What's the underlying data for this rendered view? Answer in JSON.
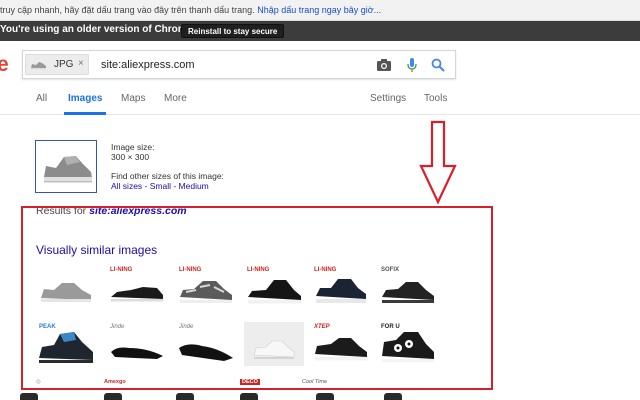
{
  "bookmark_bar": {
    "text": "truy cập nhanh, hãy đặt dấu trang vào đây trên thanh dấu trang.",
    "link": "Nhập dấu trang ngay bây giờ..."
  },
  "update_banner": {
    "message": "You're using an older version of Chrome.",
    "button_label": "Reinstall to stay secure"
  },
  "logo_fragment": "e",
  "search": {
    "chip_label": "JPG",
    "chip_close": "×",
    "query": "site:aliexpress.com",
    "icons": [
      "camera-icon",
      "mic-icon",
      "search-icon"
    ]
  },
  "tabs": {
    "all": "All",
    "images": "Images",
    "maps": "Maps",
    "more": "More",
    "settings": "Settings",
    "tools": "Tools"
  },
  "image_info": {
    "size_label": "Image size:",
    "size_value": "300 × 300",
    "other_sizes_label": "Find other sizes of this image:",
    "sizes_links": "All sizes - Small - Medium"
  },
  "results": {
    "prefix": "Results for",
    "query": "site:aliexpress.com"
  },
  "similar_heading": "Visually similar images",
  "grid": {
    "row1_brands": [
      "",
      "LI-NING",
      "LI-NING",
      "LI-NING",
      "LI-NING",
      "SOFIX"
    ],
    "row2_brands": [
      "PEAK",
      "Jinde",
      "Jinde",
      "",
      "XTEP",
      "FOR U"
    ]
  },
  "bottom_labels": [
    "Amexgo",
    "DECO",
    "Cool Time"
  ],
  "colors": {
    "accent": "#1a73e8",
    "link": "#1a0dab",
    "annotation": "#d7202b",
    "banner": "#3c3c3c"
  }
}
